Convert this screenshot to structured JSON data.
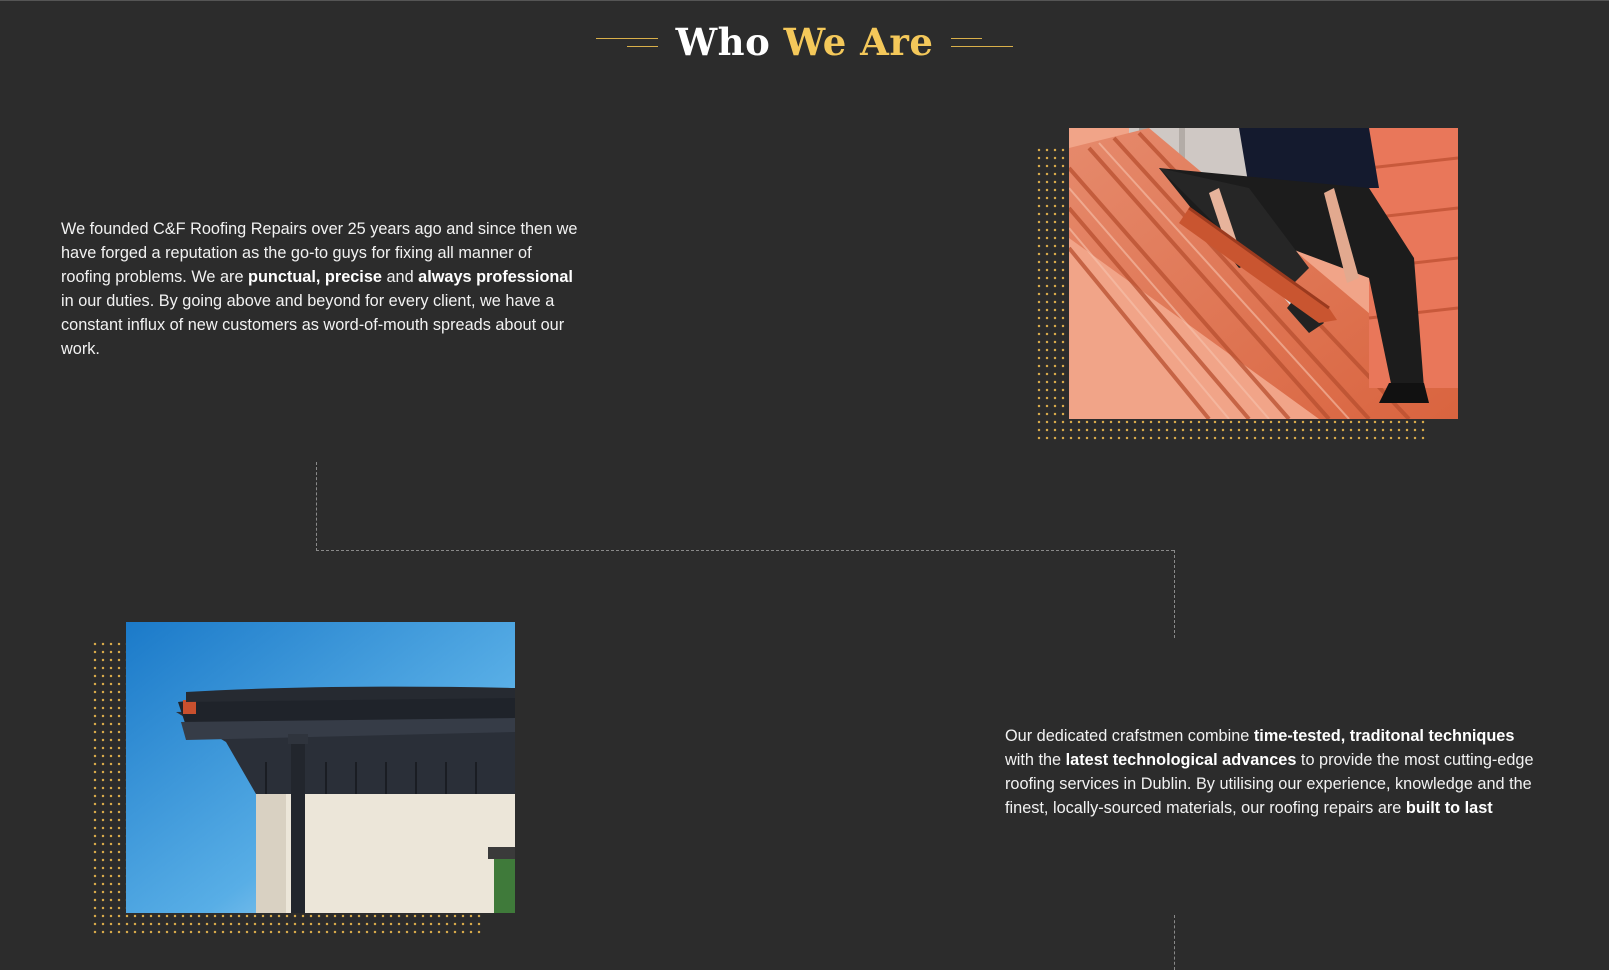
{
  "section": {
    "title_part1": "Who",
    "title_part2": "We Are",
    "accent_color": "#f4c85a"
  },
  "block1": {
    "text": [
      {
        "t": "We founded C&F Roofing Repairs over 25 years ago and since then we have forged a reputation as the go-to guys for fixing all manner of roofing problems. We are ",
        "b": false
      },
      {
        "t": "punctual, precise",
        "b": true
      },
      {
        "t": " and ",
        "b": false
      },
      {
        "t": "always professional",
        "b": true
      },
      {
        "t": " in our duties. By going above and beyond for every client, we have a constant influx of new customers as word-of-mouth spreads about our work.",
        "b": false
      }
    ],
    "image": "roofer-installing-terracotta-tiles"
  },
  "block2": {
    "text": [
      {
        "t": "Our dedicated crafstmen combine ",
        "b": false
      },
      {
        "t": "time-tested, traditonal techniques",
        "b": true
      },
      {
        "t": " with the ",
        "b": false
      },
      {
        "t": "latest technological advances",
        "b": true
      },
      {
        "t": " to provide the most cutting-edge roofing services in Dublin. By utilising our experience, knowledge and the finest, locally-sourced materials, our roofing repairs are ",
        "b": false
      },
      {
        "t": "built to last",
        "b": true
      }
    ],
    "image": "house-eave-gutter-downpipe"
  }
}
